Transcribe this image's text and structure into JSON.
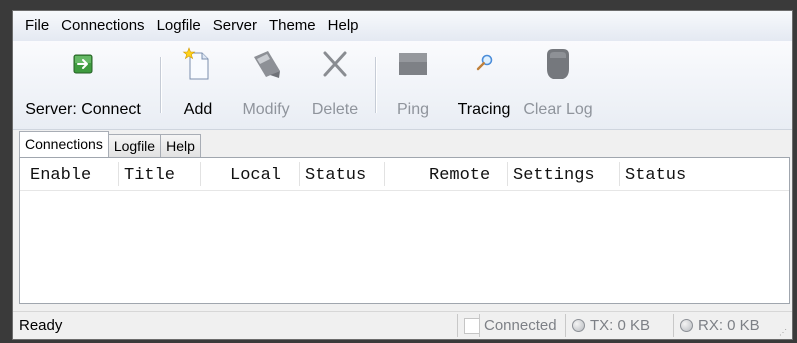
{
  "menu": {
    "items": [
      {
        "label": "File"
      },
      {
        "label": "Connections"
      },
      {
        "label": "Logfile"
      },
      {
        "label": "Server"
      },
      {
        "label": "Theme"
      },
      {
        "label": "Help"
      }
    ]
  },
  "toolbar": {
    "server_connect": {
      "label": "Server: Connect",
      "icon": "connect-arrow-icon",
      "enabled": true
    },
    "add": {
      "label": "Add",
      "icon": "new-document-icon",
      "enabled": true
    },
    "modify": {
      "label": "Modify",
      "icon": "modify-pencil-icon",
      "enabled": false
    },
    "delete": {
      "label": "Delete",
      "icon": "delete-x-icon",
      "enabled": false
    },
    "ping": {
      "label": "Ping",
      "icon": "ping-square-icon",
      "enabled": false
    },
    "tracing": {
      "label": "Tracing",
      "icon": "magnifier-icon",
      "enabled": true
    },
    "clear_log": {
      "label": "Clear Log",
      "icon": "eraser-icon",
      "enabled": false
    }
  },
  "tabs": [
    {
      "label": "Connections",
      "active": true
    },
    {
      "label": "Logfile",
      "active": false
    },
    {
      "label": "Help",
      "active": false
    }
  ],
  "grid": {
    "columns": [
      "Enable",
      "Title",
      "Local",
      "Status",
      "Remote",
      "Settings",
      "Status"
    ],
    "rows": []
  },
  "statusbar": {
    "text": "Ready",
    "connected": "Connected",
    "tx": "TX: 0 KB",
    "rx": "RX: 0 KB"
  },
  "colors": {
    "accent_green": "#3f9b3f",
    "disabled_gray": "#8f949c"
  }
}
